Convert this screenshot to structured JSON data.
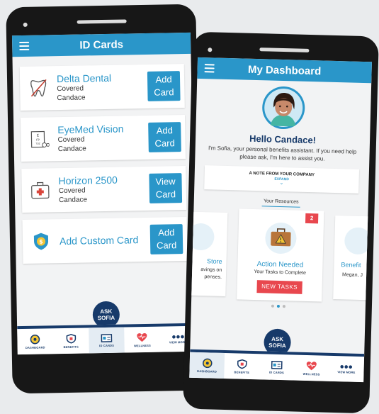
{
  "left_phone": {
    "title": "ID Cards",
    "cards": [
      {
        "title": "Delta Dental",
        "status": "Covered",
        "name": "Candace",
        "button": "Add Card",
        "icon": "tooth-icon"
      },
      {
        "title": "EyeMed Vision",
        "status": "Covered",
        "name": "Candace",
        "button": "Add Card",
        "icon": "eye-chart-icon"
      },
      {
        "title": "Horizon 2500",
        "status": "Covered",
        "name": "Candace",
        "button": "View Card",
        "icon": "medical-kit-icon"
      }
    ],
    "custom_card": {
      "title": "Add Custom Card",
      "button": "Add Card",
      "icon": "shield-dollar-icon"
    },
    "ask_sofia": {
      "line1": "ASK",
      "line2": "SOFIA"
    },
    "nav": [
      {
        "label": "DASHBOARD",
        "icon": "compass-icon"
      },
      {
        "label": "BENEFITS",
        "icon": "shield-icon"
      },
      {
        "label": "ID CARDS",
        "icon": "id-card-icon"
      },
      {
        "label": "WELLNESS",
        "icon": "heart-icon"
      },
      {
        "label": "VIEW MORE",
        "icon": "dots-icon"
      }
    ]
  },
  "right_phone": {
    "title": "My Dashboard",
    "greeting": "Hello Candace!",
    "intro": "I'm Sofia, your personal benefits assistant. If you need help please ask, I'm here to assist you.",
    "note": {
      "title": "A NOTE FROM YOUR COMPANY",
      "action": "EXPAND"
    },
    "resources_label": "Your Resources",
    "left_partial": {
      "title": "Store",
      "line1": "avings on",
      "line2": "penses."
    },
    "center": {
      "title": "Action Needed",
      "subtitle": "Your Tasks to Complete",
      "badge": "2",
      "button": "NEW TASKS"
    },
    "right_partial": {
      "title": "Benefit",
      "line1": "Megan, J"
    },
    "ask_sofia": {
      "line1": "ASK",
      "line2": "SOFIA"
    },
    "nav": [
      {
        "label": "DASHBOARD",
        "icon": "compass-icon"
      },
      {
        "label": "BENEFITS",
        "icon": "shield-icon"
      },
      {
        "label": "ID CARDS",
        "icon": "id-card-icon"
      },
      {
        "label": "WELLNESS",
        "icon": "heart-icon"
      },
      {
        "label": "VIEW MORE",
        "icon": "dots-icon"
      }
    ]
  },
  "colors": {
    "primary": "#2a96c9",
    "navy": "#173a6a",
    "alert": "#e8474e",
    "page_bg": "#e9ebed"
  }
}
